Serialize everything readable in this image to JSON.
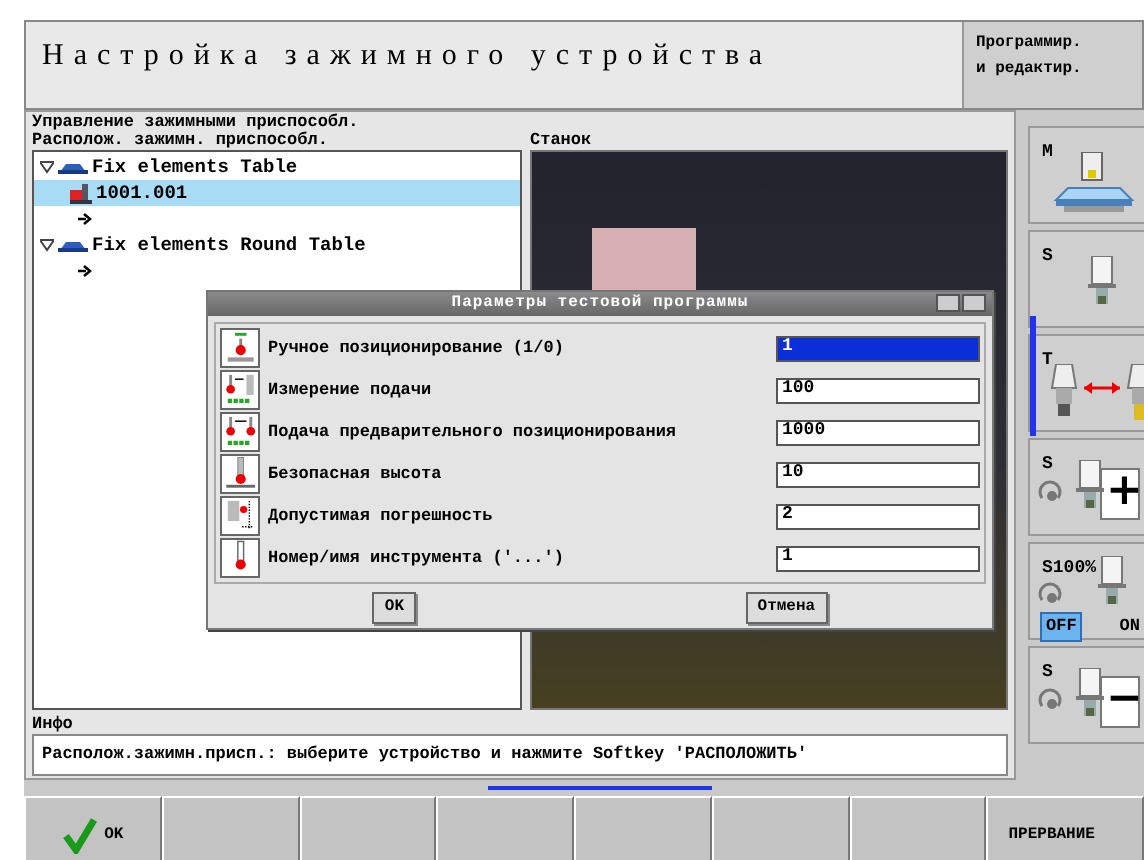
{
  "header": {
    "title": "Настройка зажимного устройства",
    "mode_line_1": "Программир.",
    "mode_line_2": "и редактир."
  },
  "panel": {
    "title": "Управление зажимными приспособл.",
    "tree_title": "Располож. зажимн. приспособл.",
    "view_title": "Станок"
  },
  "tree": [
    {
      "label": "Fix elements Table",
      "expanded": true,
      "selected": false,
      "children": [
        {
          "kind": "fixture",
          "label": "1001.001",
          "selected": true
        },
        {
          "kind": "insert",
          "selected": false
        }
      ]
    },
    {
      "label": "Fix elements Round Table",
      "expanded": true,
      "selected": false,
      "children": [
        {
          "kind": "insert",
          "selected": false
        }
      ]
    }
  ],
  "dialog": {
    "title": "Параметры тестовой программы",
    "rows": [
      {
        "label": "Ручное позиционирование (1/0)",
        "value": "1",
        "focused": true
      },
      {
        "label": "Измерение подачи",
        "value": "100",
        "focused": false
      },
      {
        "label": "Подача предварительного позиционирования",
        "value": "1000",
        "focused": false
      },
      {
        "label": "Безопасная высота",
        "value": "10",
        "focused": false
      },
      {
        "label": "Допустимая погрешность",
        "value": "2",
        "focused": false
      },
      {
        "label": "Номер/имя инструмента ('...')",
        "value": "1",
        "focused": false
      }
    ],
    "ok": "OK",
    "cancel": "Отмена"
  },
  "info": {
    "title": "Инфо",
    "text": "Располож.зажимн.присп.: выберите устройство и нажмите **Softkey** 'РАСПОЛОЖИТЬ'"
  },
  "side_keys": [
    {
      "kind": "machine",
      "label": "M"
    },
    {
      "kind": "spindle",
      "label": "S"
    },
    {
      "kind": "tool_change",
      "label": "T"
    },
    {
      "kind": "spindle_plus",
      "label": "S",
      "sign": "+"
    },
    {
      "kind": "override",
      "label": "S100%",
      "off": "OFF",
      "on": "ON",
      "off_selected": true
    },
    {
      "kind": "spindle_minus",
      "label": "S",
      "sign": "−"
    }
  ],
  "softkeys": [
    {
      "kind": "ok",
      "label": "OK"
    },
    {
      "kind": "blank"
    },
    {
      "kind": "blank"
    },
    {
      "kind": "blank"
    },
    {
      "kind": "blank"
    },
    {
      "kind": "blank"
    },
    {
      "kind": "blank"
    },
    {
      "kind": "text",
      "label": "ПРЕРВАНИЕ"
    }
  ]
}
